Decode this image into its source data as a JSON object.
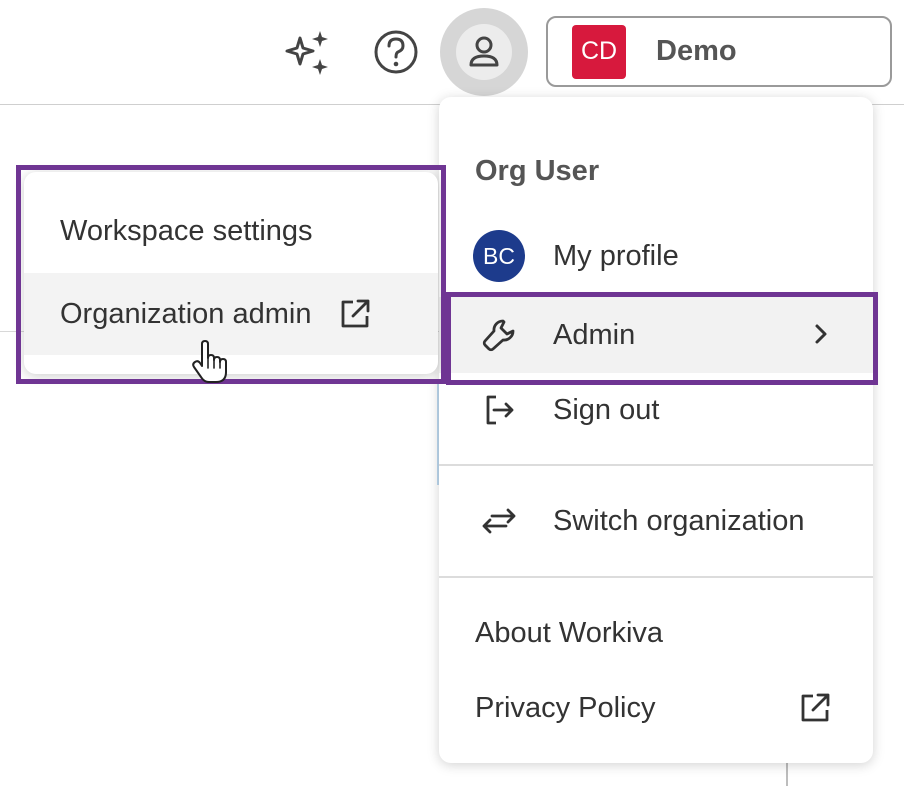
{
  "topbar": {
    "sparkle_icon": "sparkle-icon",
    "help_icon": "help-circle-icon",
    "user_icon": "user-icon",
    "org_chip": {
      "initials": "CD",
      "name": "Demo",
      "color": "#d7193d"
    }
  },
  "menu": {
    "heading": "Org User",
    "items": [
      {
        "label": "My profile",
        "avatar": "BC"
      },
      {
        "label": "Admin",
        "icon": "wrench-icon"
      },
      {
        "label": "Sign out",
        "icon": "sign-out-icon"
      },
      {
        "label": "Switch organization",
        "icon": "swap-arrows-icon"
      },
      {
        "label": "About Workiva"
      },
      {
        "label": "Privacy Policy",
        "icon": "external-link-icon"
      }
    ]
  },
  "submenu": {
    "items": [
      {
        "label": "Workspace settings"
      },
      {
        "label": "Organization admin",
        "icon": "external-link-icon"
      }
    ]
  },
  "colors": {
    "highlight_frame": "#6f3593",
    "profile_avatar": "#1d3b8c",
    "org_avatar": "#d7193d"
  }
}
